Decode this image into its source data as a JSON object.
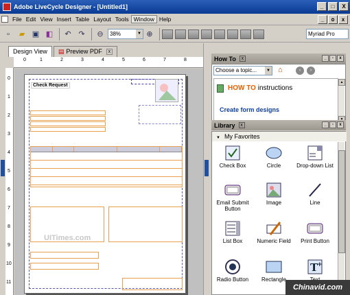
{
  "window": {
    "title": "Adobe LiveCycle Designer - [Untitled1]",
    "min_label": "_",
    "max_label": "□",
    "close_label": "X",
    "doc_min_label": "_",
    "doc_restore_label": "ᴑ",
    "doc_close_label": "x"
  },
  "menu": {
    "items": [
      "File",
      "Edit",
      "View",
      "Insert",
      "Table",
      "Layout",
      "Tools",
      "Window",
      "Help"
    ]
  },
  "toolbar": {
    "zoom": "38%",
    "font": "Myriad Pro",
    "icons": [
      "new-icon",
      "open-icon",
      "save-icon",
      "preview-icon",
      "undo-icon",
      "redo-icon",
      "zoom-out-icon",
      "zoom-in-icon",
      "grid-icon",
      "align-left-icon",
      "align-right-icon",
      "align-top-icon",
      "align-bottom-icon",
      "align-center-icon",
      "distribute-icon",
      "group-icon"
    ]
  },
  "tabs": [
    {
      "label": "Design View",
      "active": true
    },
    {
      "label": "Preview PDF",
      "active": false
    }
  ],
  "ruler": {
    "h": [
      "0",
      "1",
      "2",
      "3",
      "4",
      "5",
      "6",
      "7",
      "8"
    ],
    "v": [
      "0",
      "1",
      "2",
      "3",
      "4",
      "5",
      "6",
      "7",
      "8",
      "9",
      "10",
      "11"
    ]
  },
  "form": {
    "title": "Check Request",
    "watermark": "UITimes.com"
  },
  "howto": {
    "header": "How To",
    "topic_placeholder": "Choose a topic...",
    "title_prefix": "HOW TO",
    "title_suffix": " instructions",
    "link": "Create form designs"
  },
  "library": {
    "header": "Library",
    "group": "My Favorites",
    "items": [
      {
        "label": "Check Box",
        "icon": "checkbox-icon"
      },
      {
        "label": "Circle",
        "icon": "circle-icon"
      },
      {
        "label": "Drop-down List",
        "icon": "dropdown-list-icon"
      },
      {
        "label": "Email Submit Button",
        "icon": "email-submit-icon"
      },
      {
        "label": "Image",
        "icon": "image-icon"
      },
      {
        "label": "Line",
        "icon": "line-icon"
      },
      {
        "label": "List Box",
        "icon": "list-box-icon"
      },
      {
        "label": "Numeric Field",
        "icon": "numeric-field-icon"
      },
      {
        "label": "Print Button",
        "icon": "print-button-icon"
      },
      {
        "label": "Radio Button",
        "icon": "radio-button-icon"
      },
      {
        "label": "Rectangle",
        "icon": "rectangle-icon"
      },
      {
        "label": "Text",
        "icon": "text-icon"
      }
    ]
  },
  "watermark_corner": "Chinavid.com"
}
